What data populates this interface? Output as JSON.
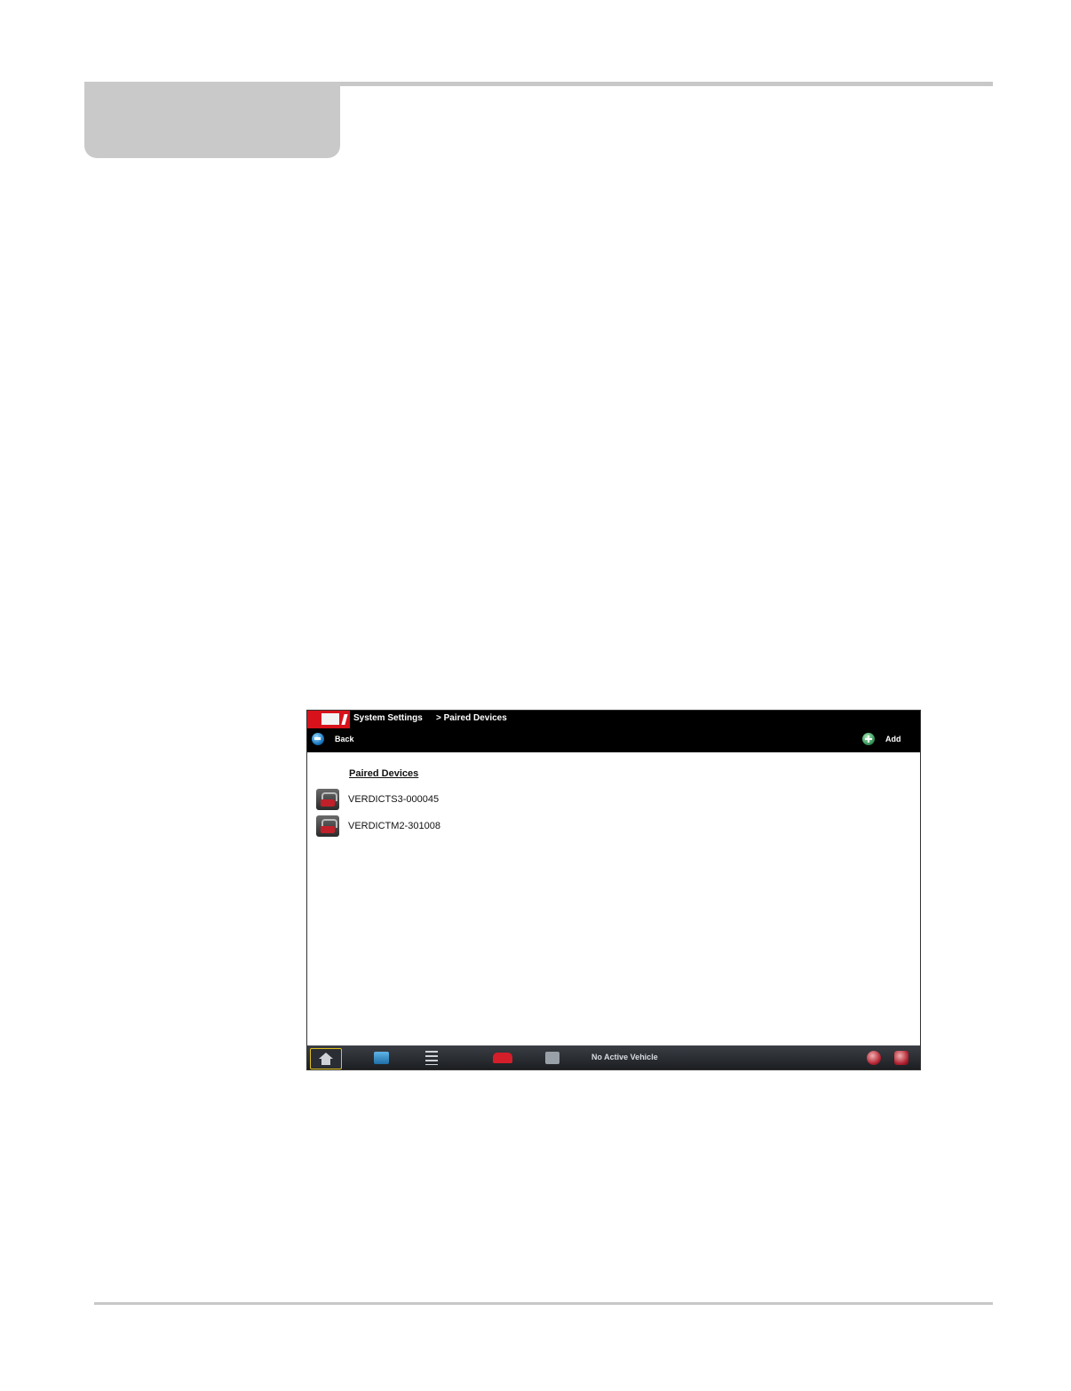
{
  "screen": {
    "breadcrumb": {
      "root": "System Settings",
      "current": "> Paired Devices"
    },
    "toolbar": {
      "back_label": "Back",
      "add_label": "Add"
    },
    "list": {
      "heading": "Paired Devices",
      "devices": [
        {
          "name": "VERDICTS3-000045"
        },
        {
          "name": "VERDICTM2-301008"
        }
      ]
    },
    "bottombar": {
      "status": "No Active Vehicle"
    },
    "colors": {
      "brand_red": "#d8121b",
      "titlebar_bg": "#000000",
      "selected_outline": "#e0c020"
    }
  }
}
